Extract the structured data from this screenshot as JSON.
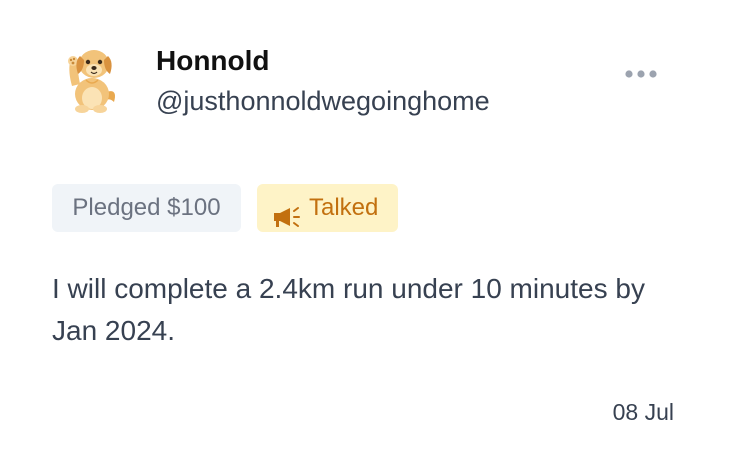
{
  "post": {
    "author_name": "Honnold",
    "author_handle": "@justhonnoldwegoinghome",
    "avatar_icon": "golden-retriever-puppy-icon",
    "more_icon": "more-options-icon",
    "pledge_label": "Pledged $100",
    "status_label": "Talked",
    "status_icon": "megaphone-icon",
    "body": "I will complete a 2.4km run under 10 minutes by Jan 2024.",
    "date": "08 Jul"
  },
  "colors": {
    "pledge_bg": "#f0f4f8",
    "pledge_text": "#6b7280",
    "status_bg": "#fef3c7",
    "status_text": "#c2700f",
    "text_primary": "#111111",
    "text_secondary": "#374151"
  }
}
